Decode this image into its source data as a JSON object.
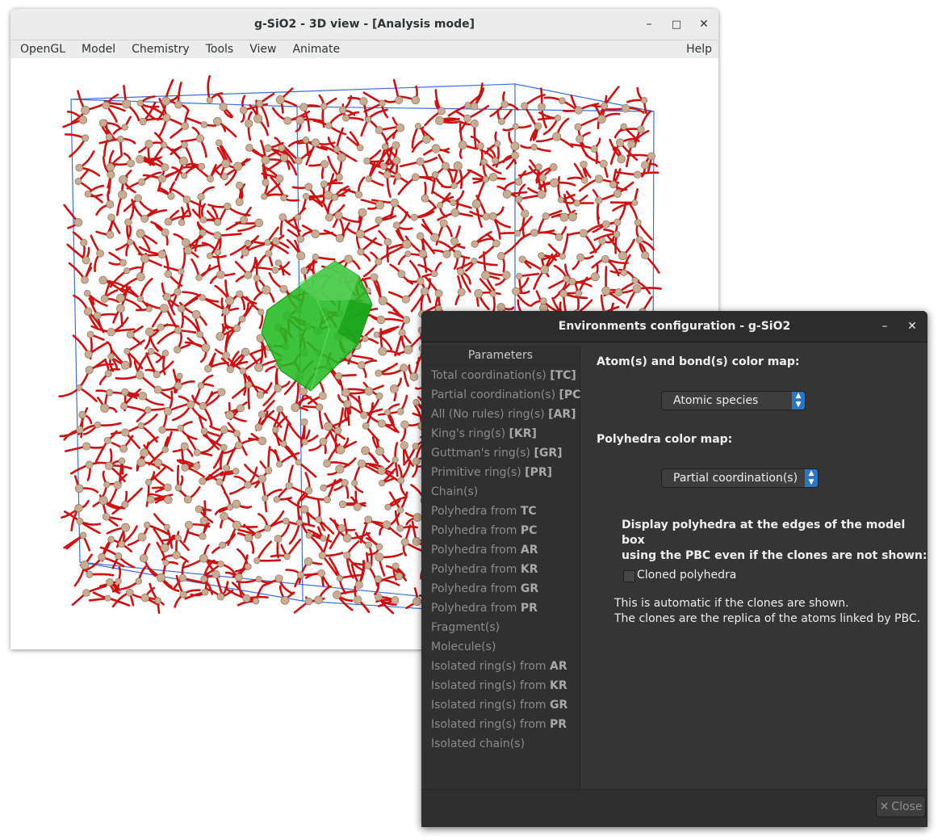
{
  "window3d": {
    "title": "g-SiO2 - 3D view - [Analysis mode]",
    "menus": [
      "OpenGL",
      "Model",
      "Chemistry",
      "Tools",
      "View",
      "Animate"
    ],
    "help": "Help",
    "controls": {
      "minimize": "–",
      "maximize": "□",
      "close": "✕"
    }
  },
  "dialog": {
    "title": "Environments configuration - g-SiO2",
    "sidebar_header": "Parameters",
    "items": [
      {
        "text": "Total coordination(s) ",
        "bold": "[TC]"
      },
      {
        "text": "Partial coordination(s) ",
        "bold": "[PC]"
      },
      {
        "text": "All (No rules) ring(s) ",
        "bold": "[AR]"
      },
      {
        "text": "King's ring(s) ",
        "bold": "[KR]"
      },
      {
        "text": "Guttman's ring(s) ",
        "bold": "[GR]"
      },
      {
        "text": "Primitive ring(s) ",
        "bold": "[PR]"
      },
      {
        "text": "Chain(s)",
        "bold": ""
      },
      {
        "text": "Polyhedra from ",
        "bold": "TC"
      },
      {
        "text": "Polyhedra from ",
        "bold": "PC"
      },
      {
        "text": "Polyhedra from ",
        "bold": "AR"
      },
      {
        "text": "Polyhedra from ",
        "bold": "KR"
      },
      {
        "text": "Polyhedra from ",
        "bold": "GR"
      },
      {
        "text": "Polyhedra from ",
        "bold": "PR"
      },
      {
        "text": "Fragment(s)",
        "bold": ""
      },
      {
        "text": "Molecule(s)",
        "bold": ""
      },
      {
        "text": "Isolated ring(s) from ",
        "bold": "AR"
      },
      {
        "text": "Isolated ring(s) from ",
        "bold": "KR"
      },
      {
        "text": "Isolated ring(s) from ",
        "bold": "GR"
      },
      {
        "text": "Isolated ring(s) from ",
        "bold": "PR"
      },
      {
        "text": "Isolated chain(s)",
        "bold": ""
      }
    ],
    "atom_map_label": "Atom(s) and bond(s) color map:",
    "atom_map_value": "Atomic species",
    "poly_map_label": "Polyhedra color map:",
    "poly_map_value": "Partial coordination(s)",
    "pbc_label_1": "Display polyhedra at the edges of the model box",
    "pbc_label_2": "using the PBC even if the clones are not shown:",
    "checkbox_label": "Cloned polyhedra",
    "checkbox_checked": false,
    "note_1": "This is automatic if the clones are shown.",
    "note_2": "The clones are the replica of the atoms linked by PBC.",
    "close_icon": "✕",
    "close_label": "Close",
    "controls": {
      "minimize": "–",
      "close": "✕"
    }
  },
  "colors": {
    "bond": "#d01010",
    "atom": "#c9ad93",
    "box": "#3a6fe0",
    "polyhedron": "#22bb22",
    "accent": "#2a76c6"
  }
}
